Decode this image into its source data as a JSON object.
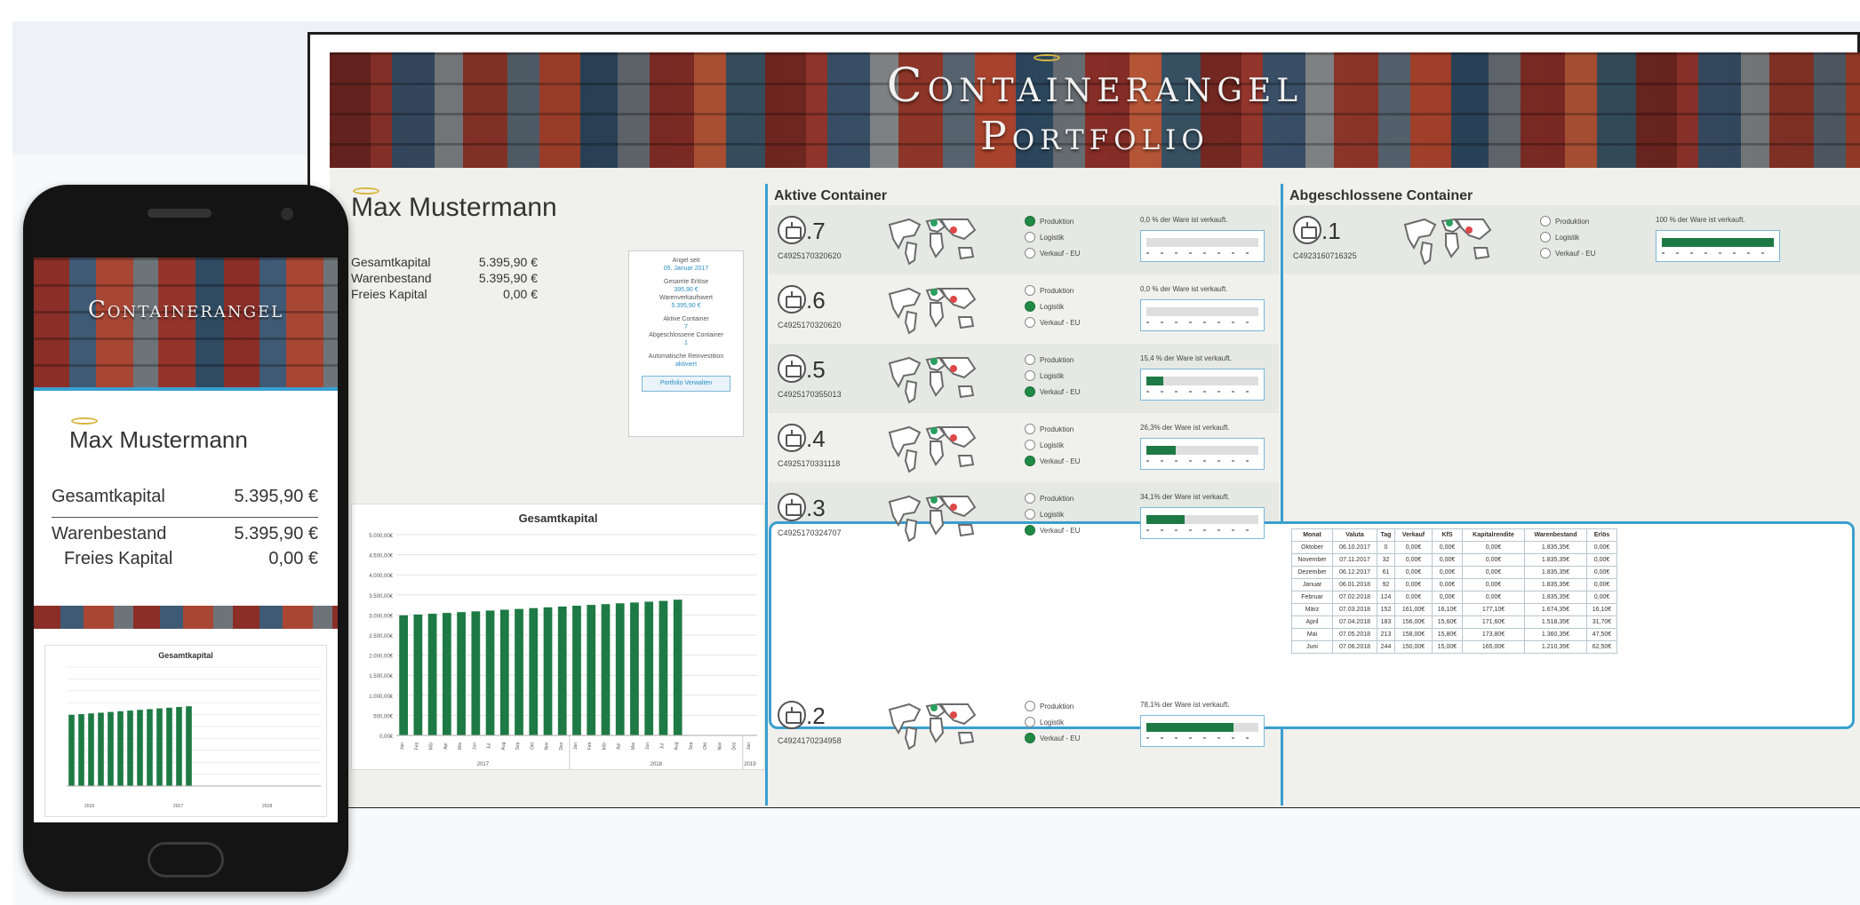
{
  "desktop": {
    "banner_title": "Containerangel",
    "banner_subtitle": "Portfolio",
    "profile": {
      "name": "Max Mustermann",
      "finance": [
        {
          "label": "Gesamtkapital",
          "value": "5.395,90 €"
        },
        {
          "label": "Warenbestand",
          "value": "5.395,90 €"
        },
        {
          "label": "Freies Kapital",
          "value": "0,00 €"
        }
      ],
      "info_card": {
        "angel_since_label": "Angel seit",
        "angel_since_value": "05. Januar 2017",
        "total_revenue_label": "Gesamte Erlöse",
        "total_revenue_value": "395,90 €",
        "goods_sale_value_label": "Warenverkaufswert",
        "goods_sale_value_value": "5.395,90 €",
        "active_label": "Aktive Container",
        "active_value": "7",
        "closed_label": "Abgeschlossene Container",
        "closed_value": "1",
        "reinvest_label": "Automatische Reinvestition",
        "reinvest_value": "aktiviert",
        "button_label": "Portfolio Verwalten"
      }
    },
    "section_active": "Aktive Container",
    "section_closed": "Abgeschlossene Container",
    "radio_labels": [
      "Produktion",
      "Logistik",
      "Verkauf - EU"
    ],
    "active_containers": [
      {
        "num": ".7",
        "id": "C4925170320620",
        "sold": "0,0 % der Ware ist verkauft.",
        "stage": 0,
        "fill": 0
      },
      {
        "num": ".6",
        "id": "C4925170320620",
        "sold": "0,0 % der Ware ist verkauft.",
        "stage": 1,
        "fill": 0
      },
      {
        "num": ".5",
        "id": "C4925170355013",
        "sold": "15,4 % der Ware ist verkauft.",
        "stage": 2,
        "fill": 0.154
      },
      {
        "num": ".4",
        "id": "C4925170331118",
        "sold": "26,3% der Ware ist verkauft.",
        "stage": 2,
        "fill": 0.263
      },
      {
        "num": ".3",
        "id": "C4925170324707",
        "sold": "34,1% der Ware ist verkauft.",
        "stage": 2,
        "fill": 0.341
      },
      {
        "num": ".2",
        "id": "C4924170234958",
        "sold": "78,1% der Ware ist verkauft.",
        "stage": 2,
        "fill": 0.781
      }
    ],
    "closed_containers": [
      {
        "num": ".1",
        "id": "C4923160716325",
        "sold": "100 % der Ware ist verkauft.",
        "stage": -1,
        "fill": 1.0
      }
    ],
    "sales_table": {
      "headers": [
        "Monat",
        "Valuta",
        "Tag",
        "Verkauf",
        "KfS",
        "Kapitalrendite",
        "Warenbestand",
        "Erlös"
      ],
      "rows": [
        [
          "Oktober",
          "06.10.2017",
          "0",
          "0,00€",
          "0,00€",
          "0,00€",
          "1.835,35€",
          "0,00€"
        ],
        [
          "November",
          "07.11.2017",
          "32",
          "0,00€",
          "0,00€",
          "0,00€",
          "1.835,35€",
          "0,00€"
        ],
        [
          "Dezember",
          "06.12.2017",
          "61",
          "0,00€",
          "0,00€",
          "0,00€",
          "1.835,35€",
          "0,00€"
        ],
        [
          "Januar",
          "06.01.2018",
          "92",
          "0,00€",
          "0,00€",
          "0,00€",
          "1.835,35€",
          "0,00€"
        ],
        [
          "Februar",
          "07.02.2018",
          "124",
          "0,00€",
          "0,00€",
          "0,00€",
          "1.835,35€",
          "0,00€"
        ],
        [
          "März",
          "07.03.2018",
          "152",
          "161,00€",
          "16,10€",
          "177,10€",
          "1.674,35€",
          "16,10€"
        ],
        [
          "April",
          "07.04.2018",
          "183",
          "156,00€",
          "15,60€",
          "171,60€",
          "1.518,35€",
          "31,70€"
        ],
        [
          "Mai",
          "07.05.2018",
          "213",
          "158,00€",
          "15,80€",
          "173,80€",
          "1.360,35€",
          "47,50€"
        ],
        [
          "Juni",
          "07.06.2018",
          "244",
          "150,00€",
          "15,00€",
          "165,00€",
          "1.210,35€",
          "62,50€"
        ]
      ]
    },
    "chart_data": {
      "type": "bar",
      "title": "Gesamtkapital",
      "ylim": [
        0,
        5000
      ],
      "y_ticks": [
        "0,00€",
        "500,00€",
        "1.000,00€",
        "1.500,00€",
        "2.000,00€",
        "2.500,00€",
        "3.000,00€",
        "3.500,00€",
        "4.000,00€",
        "4.500,00€",
        "5.000,00€"
      ],
      "categories": [
        "Jan",
        "Feb",
        "Mär",
        "Apr",
        "Mai",
        "Jun",
        "Jul",
        "Aug",
        "Sep",
        "Okt",
        "Nov",
        "Dez",
        "Jan",
        "Feb",
        "Mär",
        "Apr",
        "Mai",
        "Jun",
        "Jul",
        "Aug",
        "Sep",
        "Okt",
        "Nov",
        "Dez",
        "Jan"
      ],
      "years": [
        "2017",
        "2018",
        "2019"
      ],
      "values": [
        2990,
        3010,
        3030,
        3050,
        3070,
        3090,
        3110,
        3130,
        3150,
        3170,
        3190,
        3210,
        3230,
        3250,
        3270,
        3290,
        3310,
        3330,
        3350,
        3380,
        null,
        null,
        null,
        null,
        null
      ],
      "color": "#1e7a44"
    }
  },
  "phone": {
    "banner_title": "Containerangel",
    "name": "Max Mustermann",
    "finance": [
      {
        "label": "Gesamtkapital",
        "value": "5.395,90 €"
      },
      {
        "label": "Warenbestand",
        "value": "5.395,90 €"
      },
      {
        "label": "Freies Kapital",
        "value": "0,00 €"
      }
    ],
    "chart_title": "Gesamtkapital",
    "years": [
      "2016",
      "2017",
      "2018"
    ],
    "chart_values": [
      2990,
      3020,
      3050,
      3080,
      3110,
      3140,
      3170,
      3200,
      3230,
      3260,
      3290,
      3320,
      3350
    ]
  },
  "colors": {
    "accent": "#3a9fcf",
    "bar_green": "#1e7a44",
    "radio_on": "#1e8a46",
    "halo_gold": "#d8b640"
  }
}
